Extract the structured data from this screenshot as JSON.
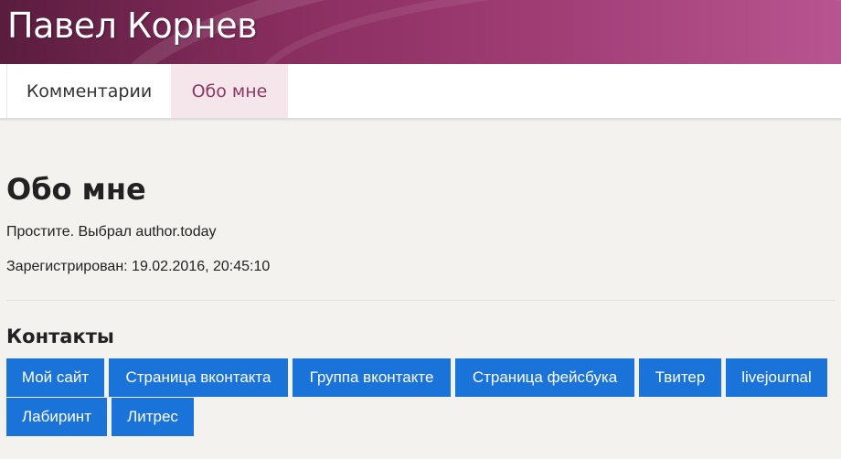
{
  "header": {
    "site_title": "Павел Корнев"
  },
  "tabs": [
    {
      "label": "Комментарии",
      "active": false
    },
    {
      "label": "Обо мне",
      "active": true
    }
  ],
  "about": {
    "title": "Обо мне",
    "text": "Простите. Выбрал author.today",
    "registered": "Зарегистрирован: 19.02.2016, 20:45:10"
  },
  "contacts": {
    "title": "Контакты",
    "buttons": [
      {
        "label": "Мой сайт"
      },
      {
        "label": "Страница вконтакта"
      },
      {
        "label": "Группа вконтакте"
      },
      {
        "label": "Страница фейсбука"
      },
      {
        "label": "Твитер"
      },
      {
        "label": "livejournal"
      },
      {
        "label": "Лабиринт"
      },
      {
        "label": "Литрес"
      }
    ]
  },
  "colors": {
    "accent_button": "#1a73d8",
    "active_tab_bg": "#f5e6ec",
    "active_tab_text": "#8a3a62",
    "banner": "#8a2e60"
  }
}
